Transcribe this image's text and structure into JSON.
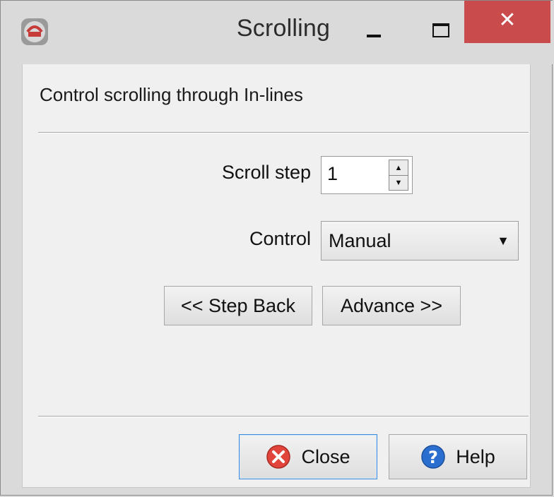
{
  "window": {
    "title": "Scrolling",
    "controls": {
      "minimize_icon": "minimize-icon",
      "maximize_icon": "maximize-icon",
      "close_glyph": "✕"
    }
  },
  "description": "Control scrolling through In-lines",
  "form": {
    "scroll_step": {
      "label": "Scroll step",
      "value": "1",
      "up_glyph": "▲",
      "down_glyph": "▼"
    },
    "control": {
      "label": "Control",
      "selected": "Manual",
      "arrow_glyph": "▼"
    }
  },
  "navigation": {
    "step_back_label": "<< Step Back",
    "advance_label": "Advance >>"
  },
  "footer": {
    "close_label": "Close",
    "help_label": "Help"
  },
  "colors": {
    "titlebar_close_bg": "#c94b4b",
    "focus_border": "#3c8ad8",
    "close_icon_red": "#e0443a",
    "help_icon_blue": "#2a6fcf"
  }
}
